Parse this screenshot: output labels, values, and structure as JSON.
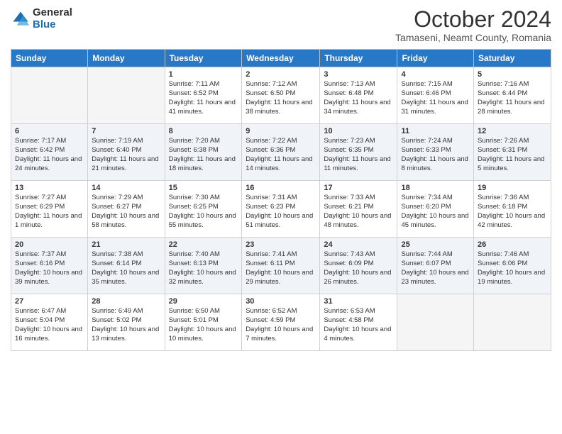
{
  "header": {
    "logo_general": "General",
    "logo_blue": "Blue",
    "month_title": "October 2024",
    "location": "Tamaseni, Neamt County, Romania"
  },
  "weekdays": [
    "Sunday",
    "Monday",
    "Tuesday",
    "Wednesday",
    "Thursday",
    "Friday",
    "Saturday"
  ],
  "weeks": [
    [
      {
        "day": "",
        "info": ""
      },
      {
        "day": "",
        "info": ""
      },
      {
        "day": "1",
        "info": "Sunrise: 7:11 AM\nSunset: 6:52 PM\nDaylight: 11 hours and 41 minutes."
      },
      {
        "day": "2",
        "info": "Sunrise: 7:12 AM\nSunset: 6:50 PM\nDaylight: 11 hours and 38 minutes."
      },
      {
        "day": "3",
        "info": "Sunrise: 7:13 AM\nSunset: 6:48 PM\nDaylight: 11 hours and 34 minutes."
      },
      {
        "day": "4",
        "info": "Sunrise: 7:15 AM\nSunset: 6:46 PM\nDaylight: 11 hours and 31 minutes."
      },
      {
        "day": "5",
        "info": "Sunrise: 7:16 AM\nSunset: 6:44 PM\nDaylight: 11 hours and 28 minutes."
      }
    ],
    [
      {
        "day": "6",
        "info": "Sunrise: 7:17 AM\nSunset: 6:42 PM\nDaylight: 11 hours and 24 minutes."
      },
      {
        "day": "7",
        "info": "Sunrise: 7:19 AM\nSunset: 6:40 PM\nDaylight: 11 hours and 21 minutes."
      },
      {
        "day": "8",
        "info": "Sunrise: 7:20 AM\nSunset: 6:38 PM\nDaylight: 11 hours and 18 minutes."
      },
      {
        "day": "9",
        "info": "Sunrise: 7:22 AM\nSunset: 6:36 PM\nDaylight: 11 hours and 14 minutes."
      },
      {
        "day": "10",
        "info": "Sunrise: 7:23 AM\nSunset: 6:35 PM\nDaylight: 11 hours and 11 minutes."
      },
      {
        "day": "11",
        "info": "Sunrise: 7:24 AM\nSunset: 6:33 PM\nDaylight: 11 hours and 8 minutes."
      },
      {
        "day": "12",
        "info": "Sunrise: 7:26 AM\nSunset: 6:31 PM\nDaylight: 11 hours and 5 minutes."
      }
    ],
    [
      {
        "day": "13",
        "info": "Sunrise: 7:27 AM\nSunset: 6:29 PM\nDaylight: 11 hours and 1 minute."
      },
      {
        "day": "14",
        "info": "Sunrise: 7:29 AM\nSunset: 6:27 PM\nDaylight: 10 hours and 58 minutes."
      },
      {
        "day": "15",
        "info": "Sunrise: 7:30 AM\nSunset: 6:25 PM\nDaylight: 10 hours and 55 minutes."
      },
      {
        "day": "16",
        "info": "Sunrise: 7:31 AM\nSunset: 6:23 PM\nDaylight: 10 hours and 51 minutes."
      },
      {
        "day": "17",
        "info": "Sunrise: 7:33 AM\nSunset: 6:21 PM\nDaylight: 10 hours and 48 minutes."
      },
      {
        "day": "18",
        "info": "Sunrise: 7:34 AM\nSunset: 6:20 PM\nDaylight: 10 hours and 45 minutes."
      },
      {
        "day": "19",
        "info": "Sunrise: 7:36 AM\nSunset: 6:18 PM\nDaylight: 10 hours and 42 minutes."
      }
    ],
    [
      {
        "day": "20",
        "info": "Sunrise: 7:37 AM\nSunset: 6:16 PM\nDaylight: 10 hours and 39 minutes."
      },
      {
        "day": "21",
        "info": "Sunrise: 7:38 AM\nSunset: 6:14 PM\nDaylight: 10 hours and 35 minutes."
      },
      {
        "day": "22",
        "info": "Sunrise: 7:40 AM\nSunset: 6:13 PM\nDaylight: 10 hours and 32 minutes."
      },
      {
        "day": "23",
        "info": "Sunrise: 7:41 AM\nSunset: 6:11 PM\nDaylight: 10 hours and 29 minutes."
      },
      {
        "day": "24",
        "info": "Sunrise: 7:43 AM\nSunset: 6:09 PM\nDaylight: 10 hours and 26 minutes."
      },
      {
        "day": "25",
        "info": "Sunrise: 7:44 AM\nSunset: 6:07 PM\nDaylight: 10 hours and 23 minutes."
      },
      {
        "day": "26",
        "info": "Sunrise: 7:46 AM\nSunset: 6:06 PM\nDaylight: 10 hours and 19 minutes."
      }
    ],
    [
      {
        "day": "27",
        "info": "Sunrise: 6:47 AM\nSunset: 5:04 PM\nDaylight: 10 hours and 16 minutes."
      },
      {
        "day": "28",
        "info": "Sunrise: 6:49 AM\nSunset: 5:02 PM\nDaylight: 10 hours and 13 minutes."
      },
      {
        "day": "29",
        "info": "Sunrise: 6:50 AM\nSunset: 5:01 PM\nDaylight: 10 hours and 10 minutes."
      },
      {
        "day": "30",
        "info": "Sunrise: 6:52 AM\nSunset: 4:59 PM\nDaylight: 10 hours and 7 minutes."
      },
      {
        "day": "31",
        "info": "Sunrise: 6:53 AM\nSunset: 4:58 PM\nDaylight: 10 hours and 4 minutes."
      },
      {
        "day": "",
        "info": ""
      },
      {
        "day": "",
        "info": ""
      }
    ]
  ]
}
